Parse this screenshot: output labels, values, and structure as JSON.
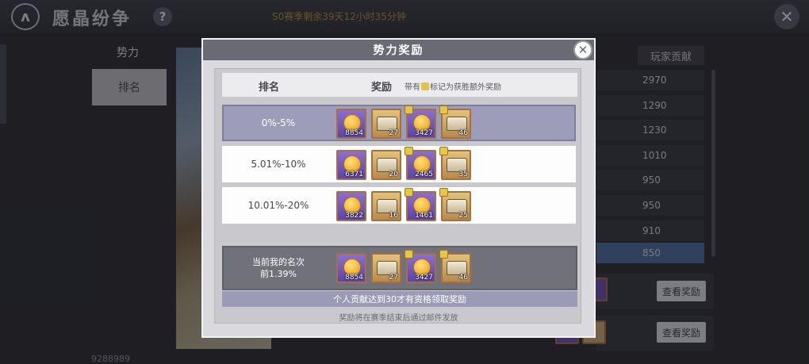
{
  "game": {
    "title": "愿晶纷争",
    "help_label": "?",
    "season_text": "S0赛季剩余39天12小时35分钟",
    "close_label": "✕",
    "logo_label": "ʌ"
  },
  "sidebar": {
    "section_label": "势力",
    "tab_label": "排名"
  },
  "background": {
    "bottom_number": "9288989",
    "contrib_header": "玩家贡献",
    "contrib_values": [
      "2970",
      "1290",
      "1230",
      "1010",
      "950",
      "950",
      "910",
      "850"
    ],
    "reward_button_label": "查看奖励"
  },
  "modal": {
    "title": "势力奖励",
    "close_label": "✕",
    "header": {
      "rank_label": "排名",
      "reward_label": "奖励",
      "note_prefix": "带有",
      "note_suffix": "标记为获胜额外奖励"
    },
    "rows": [
      {
        "label": "0%-5%",
        "items": [
          {
            "kind": "coin",
            "frame": "purple",
            "qty": "8854",
            "winner": false
          },
          {
            "kind": "chest",
            "frame": "gold",
            "qty": "27",
            "winner": false
          },
          {
            "kind": "coin",
            "frame": "purple",
            "qty": "3427",
            "winner": true
          },
          {
            "kind": "chest",
            "frame": "gold",
            "qty": "46",
            "winner": true
          }
        ]
      },
      {
        "label": "5.01%-10%",
        "items": [
          {
            "kind": "coin",
            "frame": "purple",
            "qty": "6371",
            "winner": false
          },
          {
            "kind": "chest",
            "frame": "gold",
            "qty": "20",
            "winner": false
          },
          {
            "kind": "coin",
            "frame": "purple",
            "qty": "2465",
            "winner": true
          },
          {
            "kind": "chest",
            "frame": "gold",
            "qty": "35",
            "winner": true
          }
        ]
      },
      {
        "label": "10.01%-20%",
        "items": [
          {
            "kind": "coin",
            "frame": "purple",
            "qty": "3822",
            "winner": false
          },
          {
            "kind": "chest",
            "frame": "gold",
            "qty": "16",
            "winner": false
          },
          {
            "kind": "coin",
            "frame": "purple",
            "qty": "1461",
            "winner": true
          },
          {
            "kind": "chest",
            "frame": "gold",
            "qty": "25",
            "winner": true
          }
        ]
      }
    ],
    "my_rank": {
      "label_line1": "当前我的名次",
      "label_line2": "前1.39%",
      "items": [
        {
          "kind": "coin",
          "frame": "purple",
          "qty": "8854",
          "winner": false
        },
        {
          "kind": "chest",
          "frame": "gold",
          "qty": "27",
          "winner": false
        },
        {
          "kind": "coin",
          "frame": "purple",
          "qty": "3427",
          "winner": true
        },
        {
          "kind": "chest",
          "frame": "gold",
          "qty": "46",
          "winner": true
        }
      ]
    },
    "requirement_text": "个人贡献达到30才有资格领取奖励",
    "footnote": "奖励将在赛季结束后通过邮件发放"
  }
}
